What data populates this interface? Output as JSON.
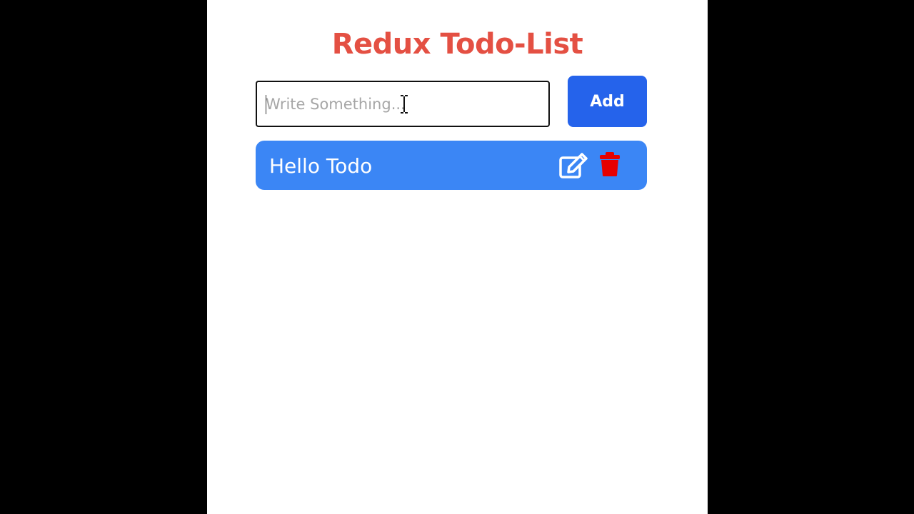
{
  "app": {
    "title": "Redux Todo-List"
  },
  "input": {
    "placeholder": "Write Something...",
    "value": ""
  },
  "add_button": {
    "label": "Add"
  },
  "todos": [
    {
      "text": "Hello Todo",
      "edit_icon": "edit-icon",
      "delete_icon": "trash-icon"
    }
  ],
  "colors": {
    "title": "#e45043",
    "add_button": "#2563eb",
    "todo_item": "#3b86f5",
    "delete_icon": "#e60000",
    "background": "#000000",
    "panel": "#ffffff"
  }
}
